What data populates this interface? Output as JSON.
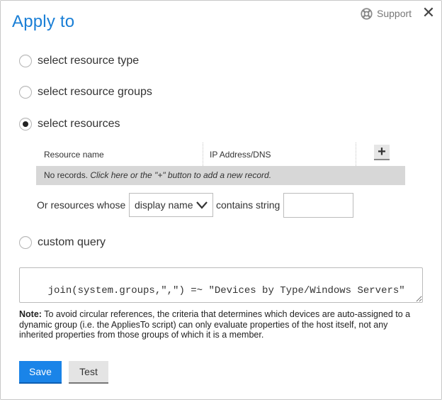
{
  "dialog": {
    "title": "Apply to",
    "support_label": "Support",
    "close_glyph": "✕"
  },
  "options": {
    "resource_type": {
      "label": "select resource type",
      "checked": false
    },
    "resource_groups": {
      "label": "select resource groups",
      "checked": false
    },
    "resources": {
      "label": "select resources",
      "checked": true
    },
    "custom_query": {
      "label": "custom query",
      "checked": false
    }
  },
  "resources_table": {
    "columns": [
      "Resource name",
      "IP Address/DNS"
    ],
    "add_glyph": "+",
    "empty_prefix": "No records.",
    "empty_hint": " Click here or the \"+\" button to add a new record."
  },
  "filter": {
    "prefix": "Or resources whose",
    "property_selected": "display name",
    "operator_label": "contains string",
    "value": ""
  },
  "query": {
    "value": "join(system.groups,\",\") =~ \"Devices by Type/Windows Servers\""
  },
  "note": {
    "label": "Note:",
    "text": " To avoid circular references, the criteria that determines which devices are auto-assigned to a dynamic group (i.e. the AppliesTo script) can only evaluate properties of the host itself, not any inherited properties from those groups of which it is a member."
  },
  "actions": {
    "save_label": "Save",
    "test_label": "Test"
  },
  "colors": {
    "accent": "#1a7fd6",
    "primary_button": "#1a84e8"
  }
}
